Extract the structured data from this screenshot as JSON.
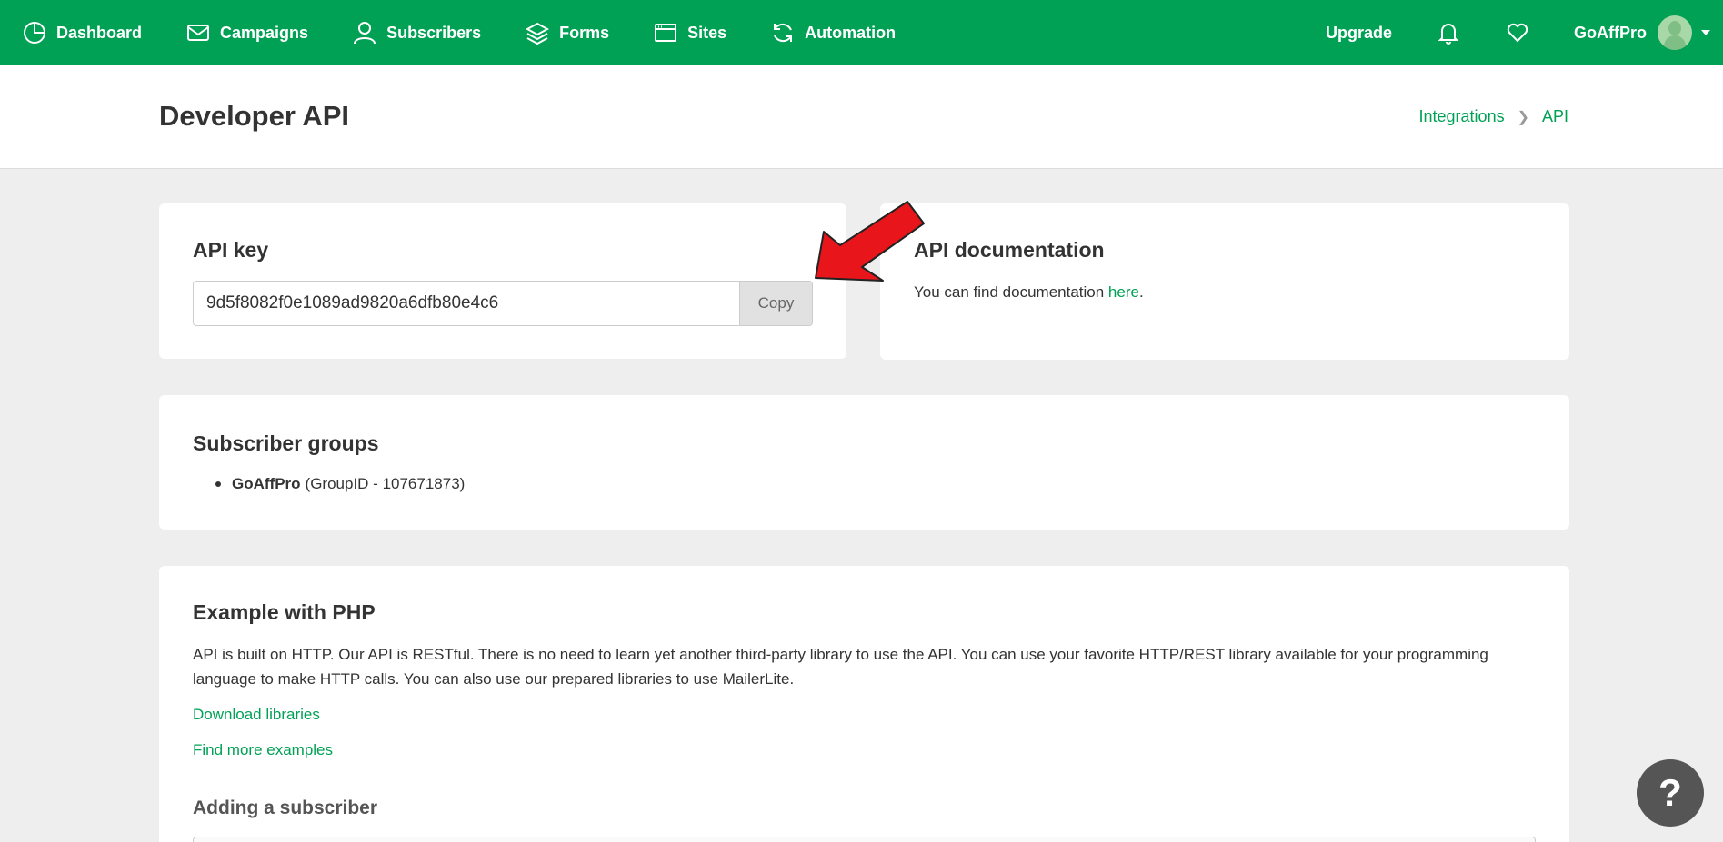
{
  "nav": {
    "items": [
      {
        "label": "Dashboard",
        "icon": "pie-chart-icon"
      },
      {
        "label": "Campaigns",
        "icon": "envelope-icon"
      },
      {
        "label": "Subscribers",
        "icon": "user-icon"
      },
      {
        "label": "Forms",
        "icon": "layers-icon"
      },
      {
        "label": "Sites",
        "icon": "browser-window-icon"
      },
      {
        "label": "Automation",
        "icon": "refresh-icon"
      }
    ],
    "upgrade_label": "Upgrade",
    "account_name": "GoAffPro"
  },
  "header": {
    "title": "Developer API",
    "breadcrumb": [
      "Integrations",
      "API"
    ]
  },
  "api_key": {
    "heading": "API key",
    "value": "9d5f8082f0e1089ad9820a6dfb80e4c6",
    "copy_label": "Copy"
  },
  "api_docs": {
    "heading": "API documentation",
    "text": "You can find documentation ",
    "link": "here",
    "suffix": "."
  },
  "subscriber_groups": {
    "heading": "Subscriber groups",
    "items": [
      {
        "name": "GoAffPro",
        "meta": "(GroupID - 107671873)"
      }
    ]
  },
  "php_example": {
    "heading": "Example with PHP",
    "description": "API is built on HTTP. Our API is RESTful. There is no need to learn yet another third-party library to use the API. You can use your favorite HTTP/REST library available for your programming language to make HTTP calls. You can also use our prepared libraries to use MailerLite.",
    "links": [
      "Download libraries",
      "Find more examples"
    ],
    "subheading": "Adding a subscriber"
  },
  "help_label": "?",
  "colors": {
    "brand": "#00a154",
    "annotation_arrow": "#e8161b"
  }
}
